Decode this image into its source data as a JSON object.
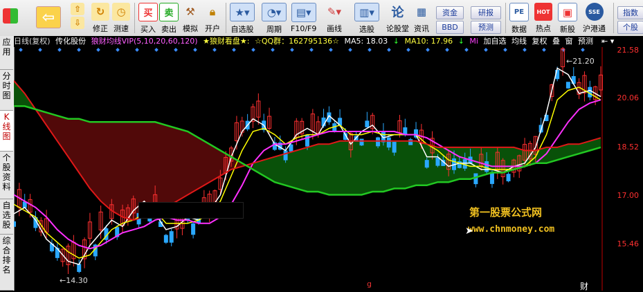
{
  "toolbar": {
    "buttons": [
      {
        "name": "app-logo-icon",
        "label": "",
        "x": 0
      },
      {
        "name": "back-button",
        "label": "",
        "x": 0
      },
      {
        "name": "modify-button",
        "label": "修正"
      },
      {
        "name": "speed-test-button",
        "label": "测速"
      },
      {
        "name": "buy-button",
        "label": "买入",
        "icon_text": "买"
      },
      {
        "name": "sell-button",
        "label": "卖出",
        "icon_text": "卖"
      },
      {
        "name": "simulate-button",
        "label": "模拟"
      },
      {
        "name": "open-account-button",
        "label": "开户"
      },
      {
        "name": "watchlist-button",
        "label": "自选股"
      },
      {
        "name": "period-button",
        "label": "周期"
      },
      {
        "name": "f10-button",
        "label": "F10/F9"
      },
      {
        "name": "draw-line-button",
        "label": "画线"
      },
      {
        "name": "stock-select-button",
        "label": "选股"
      },
      {
        "name": "forum-button",
        "label": "论股堂",
        "icon_text": "论"
      },
      {
        "name": "info-button",
        "label": "资讯"
      },
      {
        "name": "data-button",
        "label": "数据",
        "icon_text": "PE"
      },
      {
        "name": "hot-button",
        "label": "热点",
        "icon_text": "HOT"
      },
      {
        "name": "new-stock-button",
        "label": "新股"
      },
      {
        "name": "hk-connect-button",
        "label": "沪港通",
        "icon_text": "SSE"
      }
    ],
    "pills": {
      "fund": "资金",
      "research": "研报",
      "bbd": "BBD",
      "forecast": "预测",
      "index": "指数",
      "stock": "个股"
    }
  },
  "side_tabs": [
    "应用",
    "分时图",
    "K线图",
    "个股资料",
    "自选股",
    "综合排名"
  ],
  "info_bar": {
    "period": "日线(复权)",
    "stock_name": "传化股份",
    "indicator": "狼财均线VIP(5,10,20,60,120)",
    "tag": "★狼财看盘★:",
    "qq": "☆QQ群：162795136☆",
    "ma5": "MA5: 18.03",
    "ma5_arrow": "↓",
    "ma10": "MA10: 17.96",
    "ma10_arrow": "↓",
    "mi": "Mi",
    "add_watch": "加自选",
    "avg_line": "均线",
    "restore": "复权",
    "overlay": "叠",
    "window": "窗",
    "forecast": "预测"
  },
  "price_axis": [
    "21.58",
    "20.06",
    "18.52",
    "17.00",
    "15.46"
  ],
  "annotations": {
    "high": "21.20",
    "low": "14.30",
    "bottom_right": "财",
    "bottom_mid": "g"
  },
  "watermark": {
    "title": "第一股票公式网",
    "url": "www.chnmoney.com"
  },
  "colors": {
    "up": "#ff3030",
    "down": "#2aa8ff",
    "ma5": "#ffffff",
    "ma10": "#ffff00",
    "ma20": "#ff30ff",
    "ma60": "#e01818",
    "ma120": "#22c822",
    "fill_green": "#0a5a0a",
    "fill_red": "#5a0a0a",
    "axis": "#c00000"
  },
  "chart_data": {
    "type": "line",
    "title": "",
    "ylim": [
      14.3,
      21.6
    ],
    "series": [
      {
        "name": "MA5",
        "values": [
          16.4,
          16.6,
          16.2,
          15.6,
          15.3,
          14.9,
          14.8,
          15.4,
          15.8,
          16.2,
          16.0,
          16.5,
          16.8,
          16.4,
          15.9,
          16.0,
          16.3,
          16.2,
          16.5,
          17.0,
          18.2,
          19.0,
          19.4,
          19.2,
          18.6,
          18.4,
          18.9,
          19.1,
          18.9,
          19.5,
          19.2,
          18.6,
          19.0,
          19.2,
          18.8,
          18.9,
          18.9,
          18.9,
          18.2,
          18.2,
          17.9,
          18.0,
          18.0,
          17.8,
          17.8,
          17.7,
          17.9,
          18.0,
          18.5,
          19.6,
          21.0,
          20.8,
          20.2,
          20.3,
          20.1
        ]
      },
      {
        "name": "MA10",
        "values": [
          16.7,
          16.5,
          16.3,
          15.8,
          15.5,
          15.2,
          15.0,
          15.1,
          15.5,
          15.9,
          16.1,
          16.2,
          16.4,
          16.5,
          16.1,
          16.1,
          16.1,
          16.2,
          16.4,
          16.8,
          17.6,
          18.4,
          19.0,
          19.1,
          18.9,
          18.6,
          18.8,
          18.9,
          18.9,
          19.1,
          19.2,
          18.9,
          18.9,
          19.0,
          18.9,
          18.9,
          18.9,
          18.9,
          18.6,
          18.4,
          18.1,
          18.0,
          17.9,
          17.9,
          17.8,
          17.8,
          17.8,
          17.9,
          18.2,
          18.9,
          20.0,
          20.3,
          20.4,
          20.2,
          20.0
        ]
      },
      {
        "name": "MA20",
        "values": [
          17.0,
          16.8,
          16.6,
          16.3,
          15.9,
          15.6,
          15.4,
          15.3,
          15.4,
          15.6,
          15.8,
          15.9,
          16.0,
          16.2,
          16.3,
          16.2,
          16.2,
          16.1,
          16.1,
          16.3,
          16.7,
          17.3,
          18.0,
          18.4,
          18.6,
          18.6,
          18.7,
          18.8,
          18.9,
          19.0,
          19.0,
          19.0,
          19.0,
          19.0,
          19.0,
          19.0,
          18.9,
          18.9,
          18.8,
          18.6,
          18.4,
          18.2,
          18.1,
          18.0,
          17.9,
          17.9,
          17.9,
          17.9,
          18.0,
          18.3,
          18.8,
          19.3,
          19.7,
          19.9,
          20.0
        ]
      },
      {
        "name": "MA60",
        "values": [
          20.6,
          20.2,
          19.7,
          19.2,
          18.7,
          18.2,
          17.7,
          17.2,
          16.8,
          16.5,
          16.3,
          16.2,
          16.3,
          16.4,
          16.6,
          16.8,
          17.0,
          17.2,
          17.4,
          17.6,
          17.8,
          17.9,
          18.0,
          18.1,
          18.2,
          18.3,
          18.4,
          18.5,
          18.6,
          18.6,
          18.7,
          18.7,
          18.7,
          18.7,
          18.7,
          18.7,
          18.7,
          18.7,
          18.6,
          18.5,
          18.5,
          18.5,
          18.5,
          18.5,
          18.5,
          18.5,
          18.5,
          18.4,
          18.4,
          18.5,
          18.5,
          18.6,
          18.6,
          18.7,
          18.8
        ]
      },
      {
        "name": "MA120",
        "values": [
          19.8,
          19.8,
          19.7,
          19.6,
          19.5,
          19.4,
          19.4,
          19.3,
          19.3,
          19.3,
          19.3,
          19.3,
          19.3,
          19.3,
          19.2,
          19.1,
          19.0,
          18.8,
          18.6,
          18.4,
          18.2,
          18.0,
          17.8,
          17.6,
          17.4,
          17.3,
          17.2,
          17.1,
          17.1,
          17.0,
          17.0,
          17.0,
          17.0,
          17.1,
          17.1,
          17.2,
          17.2,
          17.3,
          17.3,
          17.4,
          17.4,
          17.5,
          17.5,
          17.6,
          17.7,
          17.7,
          17.8,
          17.9,
          18.0,
          18.0,
          18.1,
          18.2,
          18.3,
          18.4,
          18.5
        ]
      }
    ]
  }
}
